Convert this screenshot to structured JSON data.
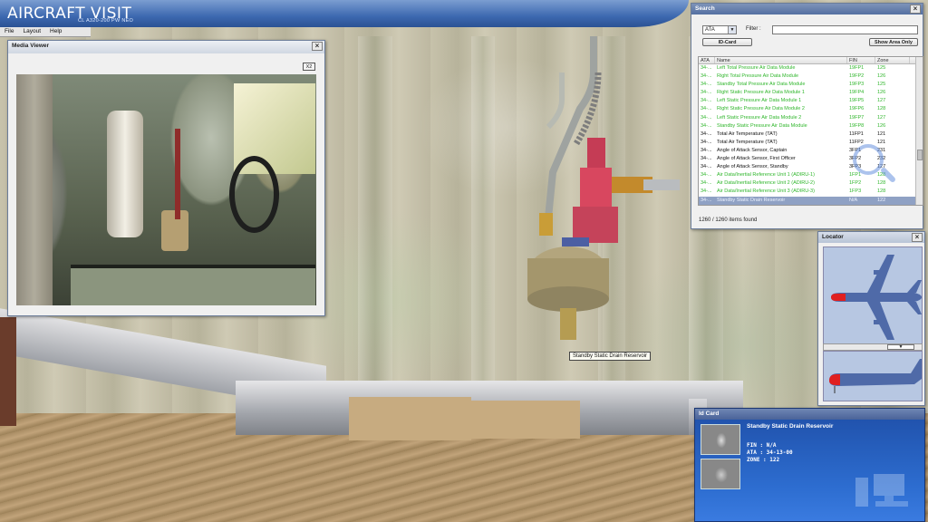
{
  "app": {
    "brand": "AIRCRAFT VISIT",
    "subtitle": "CL A320-200 PW NEO"
  },
  "menu": {
    "file": "File",
    "layout": "Layout",
    "help": "Help"
  },
  "media_viewer": {
    "title": "Media Viewer",
    "close": "×",
    "zoom_button": "X2"
  },
  "search": {
    "title": "Search",
    "close": "×",
    "ata_select": "ATA",
    "filter_label": "Filter :",
    "filter_value": "",
    "id_card_button": "ID-Card",
    "show_area_button": "Show Area Only",
    "columns": [
      "ATA",
      "Name",
      "FIN",
      "Zone"
    ],
    "rows": [
      {
        "ata": "34-...",
        "name": "Left Total Pressure Air Data Module",
        "fin": "19FP1",
        "zone": "125",
        "style": "green"
      },
      {
        "ata": "34-...",
        "name": "Right Total Pressure Air Data Module",
        "fin": "19FP2",
        "zone": "126",
        "style": "green"
      },
      {
        "ata": "34-...",
        "name": "Standby Total Pressure Air Data Module",
        "fin": "19FP3",
        "zone": "125",
        "style": "green"
      },
      {
        "ata": "34-...",
        "name": "Right Static Pressure Air Data Module 1",
        "fin": "19FP4",
        "zone": "126",
        "style": "green"
      },
      {
        "ata": "34-...",
        "name": "Left Static Pressure Air Data Module 1",
        "fin": "19FP5",
        "zone": "127",
        "style": "green"
      },
      {
        "ata": "34-...",
        "name": "Right Static Pressure Air Data Module 2",
        "fin": "19FP6",
        "zone": "128",
        "style": "green"
      },
      {
        "ata": "34-...",
        "name": "Left Static Pressure Air Data Module 2",
        "fin": "19FP7",
        "zone": "127",
        "style": "green"
      },
      {
        "ata": "34-...",
        "name": "Standby Static Pressure Air Data Module",
        "fin": "19FP8",
        "zone": "126",
        "style": "green"
      },
      {
        "ata": "34-...",
        "name": "Total Air Temperature (TAT)",
        "fin": "11FP1",
        "zone": "121",
        "style": "black"
      },
      {
        "ata": "34-...",
        "name": "Total Air Temperature (TAT)",
        "fin": "11FP2",
        "zone": "121",
        "style": "black"
      },
      {
        "ata": "34-...",
        "name": "Angle of Attack Sensor, Captain",
        "fin": "3FP1",
        "zone": "231",
        "style": "black"
      },
      {
        "ata": "34-...",
        "name": "Angle of Attack Sensor, First Officer",
        "fin": "3FP2",
        "zone": "232",
        "style": "black"
      },
      {
        "ata": "34-...",
        "name": "Angle of Attack Sensor, Standby",
        "fin": "3FP3",
        "zone": "127",
        "style": "black"
      },
      {
        "ata": "34-...",
        "name": "Air Data/Inertial Reference Unit 1 (ADIRU-1)",
        "fin": "1FP1",
        "zone": "128",
        "style": "green"
      },
      {
        "ata": "34-...",
        "name": "Air Data/Inertial Reference Unit 2 (ADIRU-2)",
        "fin": "1FP2",
        "zone": "128",
        "style": "green"
      },
      {
        "ata": "34-...",
        "name": "Air Data/Inertial Reference Unit 3 (ADIRU-3)",
        "fin": "1FP3",
        "zone": "128",
        "style": "green"
      },
      {
        "ata": "34-...",
        "name": "Standby Static Drain Reservoir",
        "fin": "N/A",
        "zone": "122",
        "style": "selected"
      }
    ],
    "items_found": "1260 / 1260 items found"
  },
  "locator": {
    "title": "Locator",
    "close": "×"
  },
  "id_card": {
    "title": "Id Card",
    "name": "Standby Static Drain Reservoir",
    "fin": "FIN : N/A",
    "ata": "ATA : 34-13-00",
    "zone": "ZONE : 122"
  },
  "tooltip": {
    "text": "Standby Static Drain Reservoir"
  },
  "colors": {
    "banner": "#3d69b0",
    "row_green": "#2fb62b",
    "row_selected": "#8fa1c4",
    "idcard_bg": "#2d6dd0",
    "locator_bg": "#b7c7e2",
    "aircraft": "#4f6aa8",
    "highlight_red": "#e02020"
  },
  "icons": [
    "close-icon",
    "dropdown-caret-icon",
    "magnifier-icon",
    "computer-icon",
    "aircraft-top-view-icon",
    "aircraft-side-view-icon"
  ]
}
